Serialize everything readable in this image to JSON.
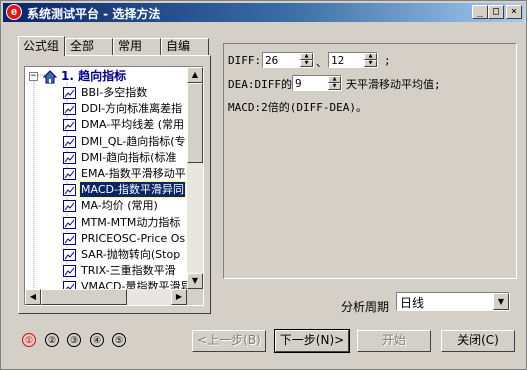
{
  "window": {
    "title": "系统测试平台 - 选择方法",
    "app_icon_glyph": "e",
    "controls": {
      "minimize": "_",
      "maximize": "□",
      "close": "×"
    }
  },
  "tabs": [
    {
      "label": "公式组",
      "active": true
    },
    {
      "label": "全部",
      "active": false
    },
    {
      "label": "常用",
      "active": false
    },
    {
      "label": "自编",
      "active": false
    }
  ],
  "tree": {
    "root": {
      "expander": "−",
      "label": "1. 趋向指标"
    },
    "items": [
      {
        "label": "BBI-多空指数",
        "selected": false
      },
      {
        "label": "DDI-方向标准离差指",
        "selected": false
      },
      {
        "label": "DMA-平均线差 (常用",
        "selected": false
      },
      {
        "label": "DMI_QL-趋向指标(专",
        "selected": false
      },
      {
        "label": "DMI-趋向指标(标准",
        "selected": false
      },
      {
        "label": "EMA-指数平滑移动平",
        "selected": false
      },
      {
        "label": "MACD-指数平滑异同",
        "selected": true
      },
      {
        "label": "MA-均价 (常用)",
        "selected": false
      },
      {
        "label": "MTM-MTM动力指标",
        "selected": false
      },
      {
        "label": "PRICEOSC-Price Os",
        "selected": false
      },
      {
        "label": "SAR-抛物转向(Stop",
        "selected": false
      },
      {
        "label": "TRIX-三重指数平滑",
        "selected": false
      },
      {
        "label": "VMACD-量指数平滑异",
        "selected": false
      }
    ]
  },
  "params": {
    "diff_label": "DIFF:",
    "diff_short": "26",
    "diff_sep": "、",
    "diff_long": "12",
    "diff_end": ";",
    "dea_prefix": "DEA:DIFF的",
    "dea_value": "9",
    "dea_suffix": "天平滑移动平均值;",
    "macd_text": "MACD:2倍的(DIFF-DEA)。"
  },
  "period": {
    "label": "分析周期",
    "value": "日线"
  },
  "steps": [
    "①",
    "②",
    "③",
    "④",
    "⑤"
  ],
  "buttons": {
    "prev": "<上一步(B)",
    "next": "下一步(N)>",
    "start": "开始",
    "close": "关闭(C)"
  },
  "colors": {
    "title_start": "#0a246a",
    "selection": "#0a246a",
    "step_current": "#e00000",
    "root_label": "#000080"
  }
}
